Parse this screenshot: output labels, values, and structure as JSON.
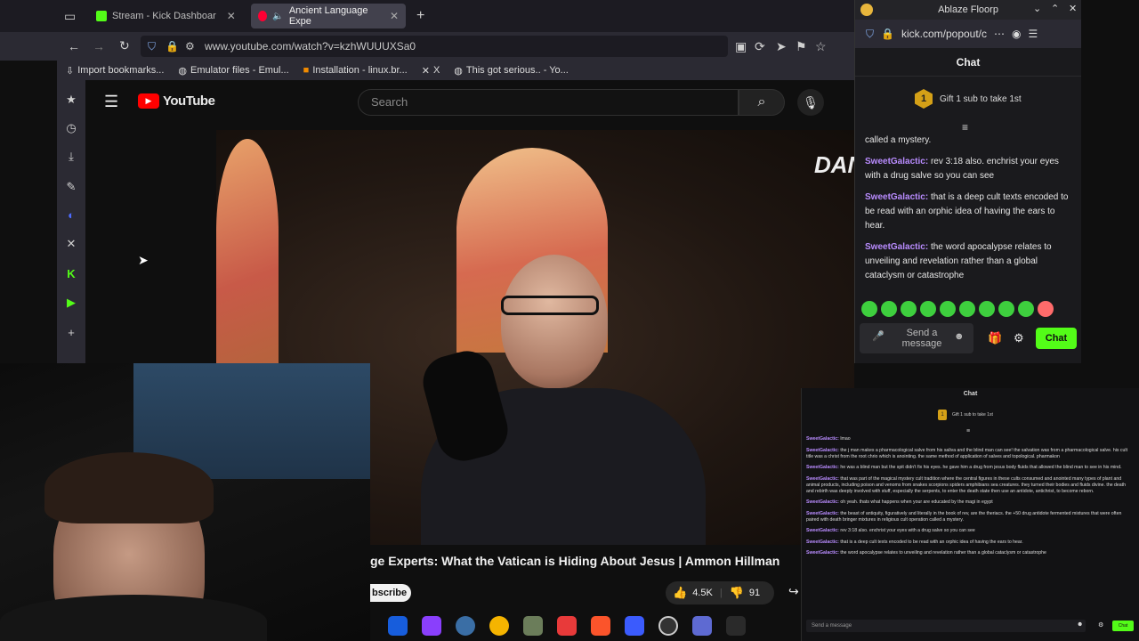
{
  "browser": {
    "tabs": [
      {
        "label": "Stream - Kick Dashboar",
        "favicon_color": "#53fc18"
      },
      {
        "label": "Ancient Language Expe",
        "favicon_color": "#ff0033"
      }
    ],
    "url": "www.youtube.com/watch?v=kzhWUUUXSa0",
    "bookmarks": [
      {
        "label": "Import bookmarks...",
        "icon": "import-icon"
      },
      {
        "label": "Emulator files - Emul...",
        "icon": "globe-icon"
      },
      {
        "label": "Installation - linux.br...",
        "icon": "brave-icon"
      },
      {
        "label": "X",
        "icon": "x-icon"
      },
      {
        "label": "This got serious.. - Yo...",
        "icon": "globe-icon"
      }
    ]
  },
  "youtube": {
    "logo": "YouTube",
    "search_placeholder": "Search",
    "overlay_text": "DANN",
    "video_title": "ge Experts: What the Vatican is Hiding About Jesus | Ammon Hillman",
    "subscribe_label": "bscribe",
    "likes": "4.5K",
    "dislikes": "91"
  },
  "kick_popout": {
    "window_title": "Ablaze Floorp",
    "url": "kick.com/popout/c",
    "chat_heading": "Chat",
    "gift_badge": "1",
    "gift_text": "Gift 1 sub to take 1st",
    "partial_message": "called a mystery.",
    "messages": [
      {
        "user": "SweetGalactic:",
        "text": "rev 3:18 also. enchrist your eyes with a drug salve so you can see"
      },
      {
        "user": "SweetGalactic:",
        "text": "that is a deep cult texts encoded to be read with an orphic idea of having the ears to hear."
      },
      {
        "user": "SweetGalactic:",
        "text": "the word apocalypse relates to unveiling and revelation rather than a global cataclysm or catastrophe"
      }
    ],
    "input_placeholder": "Send a message",
    "chat_button": "Chat",
    "accent": "#53fc18"
  },
  "mini_chat": {
    "heading": "Chat",
    "gift_badge": "1",
    "gift_text": "Gift 1 sub to take 1st",
    "messages": [
      {
        "user": "SweetGalactic:",
        "text": "lmao"
      },
      {
        "user": "SweetGalactic:",
        "text": "the j man makes a pharmacological salve from his saliva and the blind man can see! the salvation was from a pharmacological salve. his cult title was a christ from the root chrio which is anointing. the same method of application of salves and topological. pharmakon"
      },
      {
        "user": "SweetGalactic:",
        "text": "he was a blind man but the spit didn't fix his eyes. he gave him a drug from jesus body fluids that allowed the blind man to see in his mind."
      },
      {
        "user": "SweetGalactic:",
        "text": "that was part of the magical mystery cult tradition where the central figures in these cults consumed and anointed many types of plant and animal products, including poison and venoms from snakes scorpions spiders amphibians sea creatures. they turned their bodies and fluids divine. the death and rebirth was deeply involved with stuff, especially the serpents, to enter the death state then use an antidote, antichrist, to become reborn."
      },
      {
        "user": "SweetGalactic:",
        "text": "oh yeah. thats what happens when your are educated by the magi in egypt"
      },
      {
        "user": "SweetGalactic:",
        "text": "the beast of antiquity, figuratively and literally in the book of rev, are the theriacs. the +50 drug antidote fermented mixtures that were often paired with death bringer mixtures in religious cult operation called a mystery."
      },
      {
        "user": "SweetGalactic:",
        "text": "rev 3:18 also. enchrist your eyes with a drug salve so you can see"
      },
      {
        "user": "SweetGalactic:",
        "text": "that is a deep cult texts encoded to be read with an orphic idea of having the ears to hear."
      },
      {
        "user": "SweetGalactic:",
        "text": "the word apocalypse relates to unveiling and revelation rather than a global cataclysm or catastrophe"
      }
    ],
    "input_placeholder": "Send a message",
    "chat_button": "Chat"
  }
}
